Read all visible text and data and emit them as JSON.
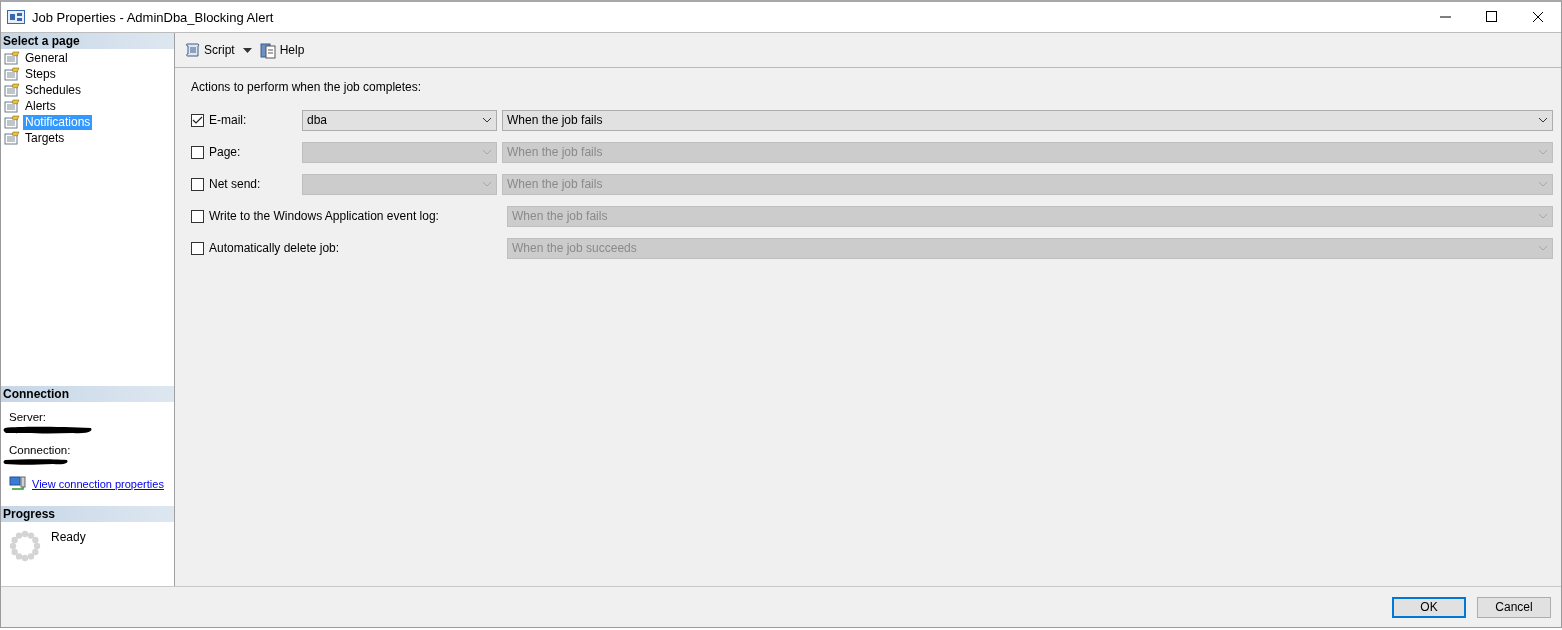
{
  "window": {
    "title": "Job Properties - AdminDba_Blocking Alert"
  },
  "sidebar": {
    "header": "Select a page",
    "items": [
      {
        "label": "General",
        "selected": false
      },
      {
        "label": "Steps",
        "selected": false
      },
      {
        "label": "Schedules",
        "selected": false
      },
      {
        "label": "Alerts",
        "selected": false
      },
      {
        "label": "Notifications",
        "selected": true
      },
      {
        "label": "Targets",
        "selected": false
      }
    ]
  },
  "connection": {
    "header": "Connection",
    "server_label": "Server:",
    "connection_label": "Connection:",
    "link": "View connection properties"
  },
  "progress": {
    "header": "Progress",
    "status": "Ready"
  },
  "toolbar": {
    "script": "Script",
    "help": "Help"
  },
  "notifications": {
    "heading": "Actions to perform when the job completes:",
    "rows": [
      {
        "kind": "recipient",
        "label": "E-mail:",
        "checked": true,
        "recipient": "dba",
        "condition": "When the job fails"
      },
      {
        "kind": "recipient",
        "label": "Page:",
        "checked": false,
        "condition": "When the job fails"
      },
      {
        "kind": "recipient",
        "label": "Net send:",
        "checked": false,
        "condition": "When the job fails"
      },
      {
        "kind": "plain",
        "label": "Write to the Windows Application event log:",
        "checked": false,
        "condition": "When the job fails"
      },
      {
        "kind": "plain",
        "label": "Automatically delete job:",
        "checked": false,
        "condition": "When the job succeeds"
      }
    ]
  },
  "buttons": [
    {
      "label": "OK",
      "selected": true
    },
    {
      "label": "Cancel",
      "selected": false
    }
  ]
}
